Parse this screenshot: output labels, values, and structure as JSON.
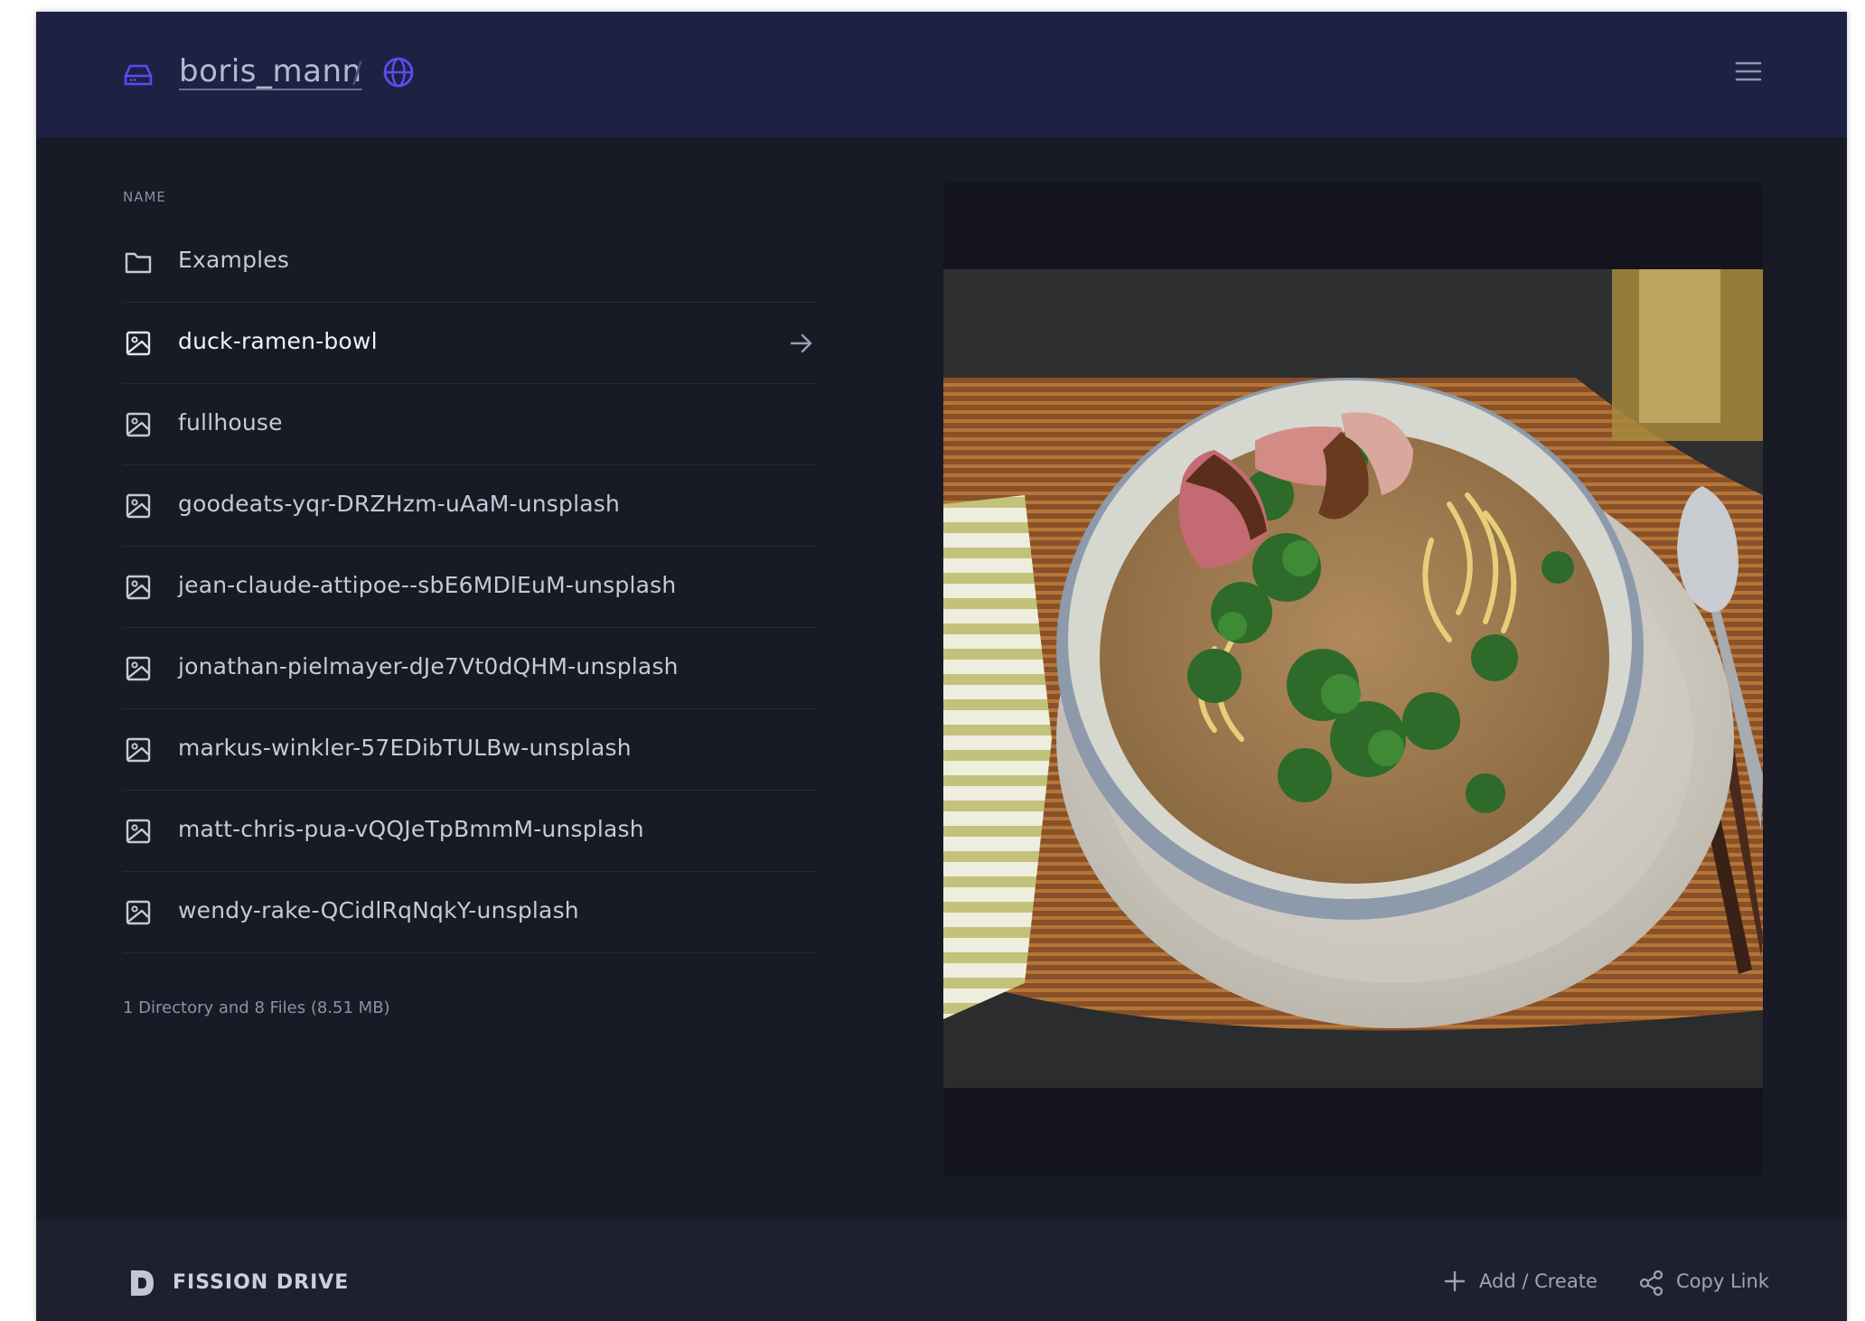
{
  "header": {
    "username": "boris_mann",
    "separator": "/",
    "drive_icon": "hard-drive-icon",
    "public_icon": "globe-icon",
    "menu_icon": "hamburger-menu-icon"
  },
  "list": {
    "column_header": "NAME",
    "items": [
      {
        "name": "Examples",
        "type": "folder",
        "icon": "folder-icon"
      },
      {
        "name": "duck-ramen-bowl",
        "type": "image",
        "icon": "image-file-icon",
        "selected": true
      },
      {
        "name": "fullhouse",
        "type": "image",
        "icon": "image-file-icon"
      },
      {
        "name": "goodeats-yqr-DRZHzm-uAaM-unsplash",
        "type": "image",
        "icon": "image-file-icon"
      },
      {
        "name": "jean-claude-attipoe--sbE6MDlEuM-unsplash",
        "type": "image",
        "icon": "image-file-icon"
      },
      {
        "name": "jonathan-pielmayer-dJe7Vt0dQHM-unsplash",
        "type": "image",
        "icon": "image-file-icon"
      },
      {
        "name": "markus-winkler-57EDibTULBw-unsplash",
        "type": "image",
        "icon": "image-file-icon"
      },
      {
        "name": "matt-chris-pua-vQQJeTpBmmM-unsplash",
        "type": "image",
        "icon": "image-file-icon"
      },
      {
        "name": "wendy-rake-QCidlRqNqkY-unsplash",
        "type": "image",
        "icon": "image-file-icon"
      }
    ],
    "summary": "1 Directory and 8 Files (8.51 MB)"
  },
  "footer": {
    "brand": "FISSION DRIVE",
    "add_label": "Add / Create",
    "copy_label": "Copy Link"
  },
  "colors": {
    "accent": "#5b4cf0",
    "header_bg": "#1d2244",
    "body_bg": "#181a26",
    "footer_bg": "#1e2030"
  }
}
